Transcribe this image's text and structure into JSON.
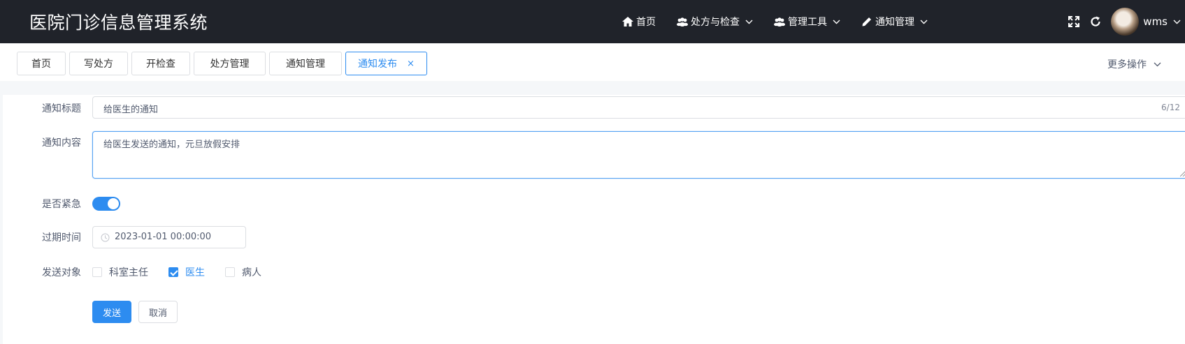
{
  "app": {
    "title": "医院门诊信息管理系统"
  },
  "nav": {
    "items": [
      {
        "label": "首页",
        "icon": "home-icon",
        "has_dropdown": false
      },
      {
        "label": "处方与检查",
        "icon": "group-icon",
        "has_dropdown": true
      },
      {
        "label": "管理工具",
        "icon": "group-icon",
        "has_dropdown": true
      },
      {
        "label": "通知管理",
        "icon": "pen-icon",
        "has_dropdown": true
      }
    ],
    "username": "wms"
  },
  "tabs": [
    {
      "label": "首页",
      "active": false
    },
    {
      "label": "写处方",
      "active": false
    },
    {
      "label": "开检查",
      "active": false
    },
    {
      "label": "处方管理",
      "active": false
    },
    {
      "label": "通知管理",
      "active": false
    },
    {
      "label": "通知发布",
      "active": true,
      "closable": true
    }
  ],
  "tab_close_symbol": "×",
  "more_ops": "更多操作",
  "form": {
    "title_label": "通知标题",
    "title_value": "给医生的通知",
    "title_count": "6/12",
    "content_label": "通知内容",
    "content_value": "给医生发送的通知，元旦放假安排",
    "urgent_label": "是否紧急",
    "urgent_on": true,
    "expire_label": "过期时间",
    "expire_value": "2023-01-01 00:00:00",
    "target_label": "发送对象",
    "targets": [
      {
        "label": "科室主任",
        "checked": false
      },
      {
        "label": "医生",
        "checked": true
      },
      {
        "label": "病人",
        "checked": false
      }
    ],
    "submit_label": "发送",
    "cancel_label": "取消"
  },
  "colors": {
    "navbar": "#20232a",
    "accent": "#2d8cf0",
    "background": "#f5f7f9"
  }
}
